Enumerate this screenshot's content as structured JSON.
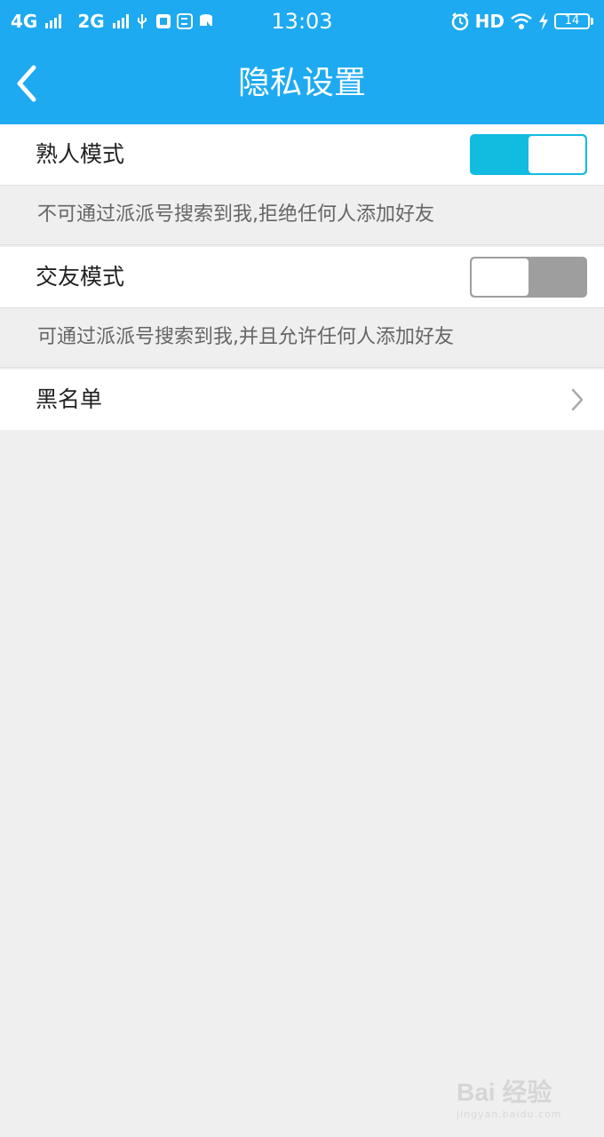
{
  "status_bar": {
    "network1": "4G",
    "network2": "2G",
    "time": "13:03",
    "hd": "HD",
    "battery": "14"
  },
  "navbar": {
    "title": "隐私设置"
  },
  "settings": {
    "acquaintance_mode": {
      "label": "熟人模式",
      "enabled": true,
      "description": "不可通过派派号搜索到我,拒绝任何人添加好友"
    },
    "friend_mode": {
      "label": "交友模式",
      "enabled": false,
      "description": "可通过派派号搜索到我,并且允许任何人添加好友"
    },
    "blacklist": {
      "label": "黑名单"
    }
  },
  "watermark": {
    "logo": "Bai 经验",
    "url": "jingyan.baidu.com"
  },
  "colors": {
    "primary": "#1eaaf1",
    "toggle_on": "#11bce0",
    "toggle_off": "#9e9e9e",
    "background": "#efefef"
  },
  "icons": [
    "back-arrow-icon",
    "chevron-right-icon",
    "usb-icon",
    "alarm-icon",
    "wifi-icon",
    "charging-icon"
  ]
}
